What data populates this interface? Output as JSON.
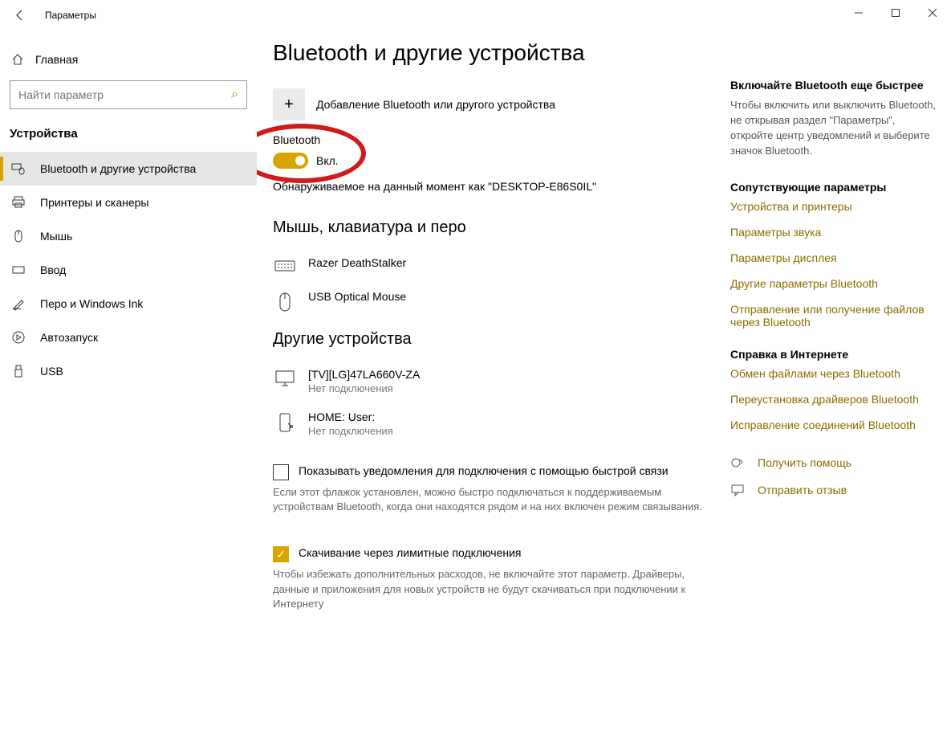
{
  "window": {
    "title": "Параметры"
  },
  "sidebar": {
    "home": "Главная",
    "search_placeholder": "Найти параметр",
    "section": "Устройства",
    "items": [
      {
        "label": "Bluetooth и другие устройства",
        "icon": "bluetooth"
      },
      {
        "label": "Принтеры и сканеры",
        "icon": "printer"
      },
      {
        "label": "Мышь",
        "icon": "mouse"
      },
      {
        "label": "Ввод",
        "icon": "keyboard"
      },
      {
        "label": "Перо и Windows Ink",
        "icon": "pen"
      },
      {
        "label": "Автозапуск",
        "icon": "autoplay"
      },
      {
        "label": "USB",
        "icon": "usb"
      }
    ]
  },
  "main": {
    "heading": "Bluetooth и другие устройства",
    "add_device": "Добавление Bluetooth или другого устройства",
    "bluetooth_label": "Bluetooth",
    "toggle_state": "Вкл.",
    "discoverable": "Обнаруживаемое на данный момент как \"DESKTOP-E86S0IL\"",
    "section_input": "Мышь, клавиатура и перо",
    "input_devices": [
      {
        "name": "Razer DeathStalker",
        "icon": "keyboard"
      },
      {
        "name": "USB Optical Mouse",
        "icon": "mouse"
      }
    ],
    "section_other": "Другие устройства",
    "other_devices": [
      {
        "name": "[TV][LG]47LA660V-ZA",
        "status": "Нет подключения",
        "icon": "monitor"
      },
      {
        "name": "HOME: User:",
        "status": "Нет подключения",
        "icon": "phone"
      }
    ],
    "notify_checkbox": "Показывать уведомления для подключения с помощью быстрой связи",
    "notify_desc": "Если этот флажок установлен, можно быстро подключаться к поддерживаемым устройствам Bluetooth, когда они находятся рядом и на них включен режим связывания.",
    "metered_checkbox": "Скачивание через лимитные подключения",
    "metered_desc": "Чтобы избежать дополнительных расходов, не включайте этот параметр. Драйверы, данные и приложения для новых устройств не будут скачиваться при подключении к Интернету"
  },
  "aside": {
    "tip_title": "Включайте Bluetooth еще быстрее",
    "tip_text": "Чтобы включить или выключить Bluetooth, не открывая раздел \"Параметры\", откройте центр уведомлений и выберите значок Bluetooth.",
    "related_title": "Сопутствующие параметры",
    "related_links": [
      "Устройства и принтеры",
      "Параметры звука",
      "Параметры дисплея",
      "Другие параметры Bluetooth",
      "Отправление или получение файлов через Bluetooth"
    ],
    "help_title": "Справка в Интернете",
    "help_links": [
      "Обмен файлами через Bluetooth",
      "Переустановка драйверов Bluetooth",
      "Исправление соединений Bluetooth"
    ],
    "get_help": "Получить помощь",
    "feedback": "Отправить отзыв"
  }
}
